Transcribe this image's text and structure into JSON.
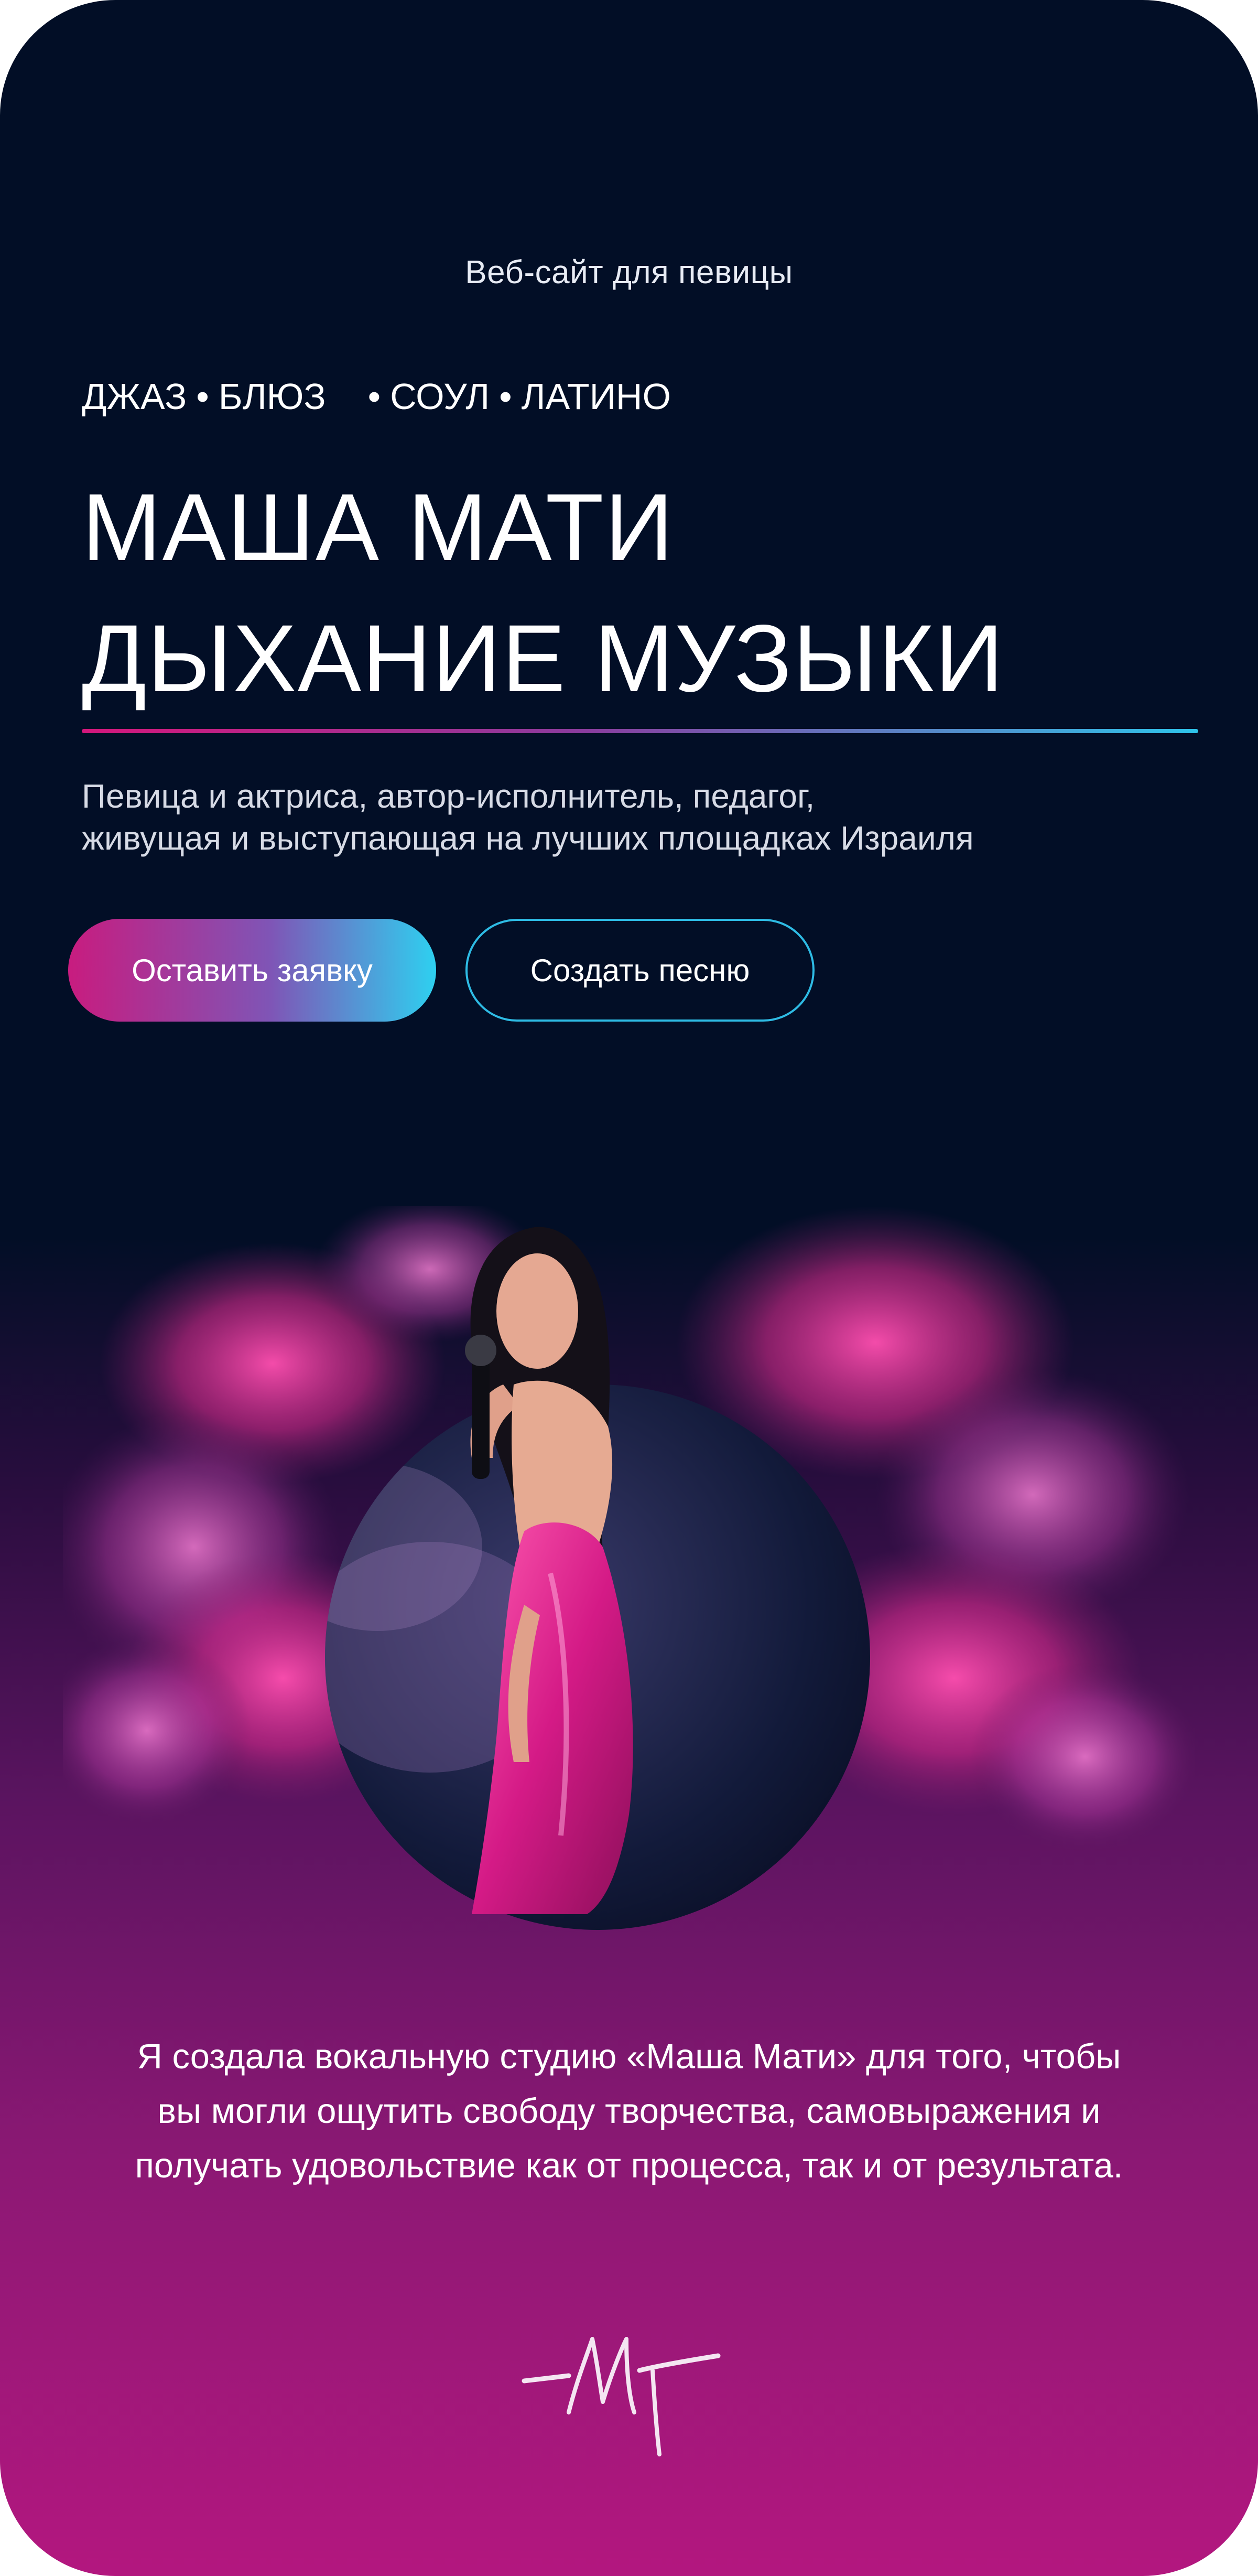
{
  "header": {
    "site_label": "Веб-сайт для певицы"
  },
  "genres": [
    "ДЖАЗ",
    "БЛЮЗ",
    "СОУЛ",
    "ЛАТИНО"
  ],
  "genre_separator": "•",
  "hero": {
    "title_line1": "МАША МАТИ",
    "title_line2": "ДЫХАНИЕ МУЗЫКИ",
    "subtitle_line1": "Певица и актриса, автор-исполнитель, педагог,",
    "subtitle_line2": "живущая и выступающая на лучших площадках Израиля"
  },
  "buttons": {
    "primary_label": "Оставить заявку",
    "secondary_label": "Создать песню"
  },
  "quote": {
    "line1": "Я создала вокальную студию «Маша Мати» для того, чтобы",
    "line2": "вы могли ощутить  свободу творчества, самовыражения и",
    "line3": "получать удовольствие  как от процесса, так и от результата."
  },
  "colors": {
    "background_top": "#020e26",
    "background_bottom": "#b3177f",
    "accent_pink": "#d4177c",
    "accent_cyan": "#2ec4ea",
    "dress": "#d41a86"
  },
  "images": {
    "hero_photo": "singer-in-pink-dress-with-microphone",
    "signature": "handwritten-signature-logo"
  }
}
